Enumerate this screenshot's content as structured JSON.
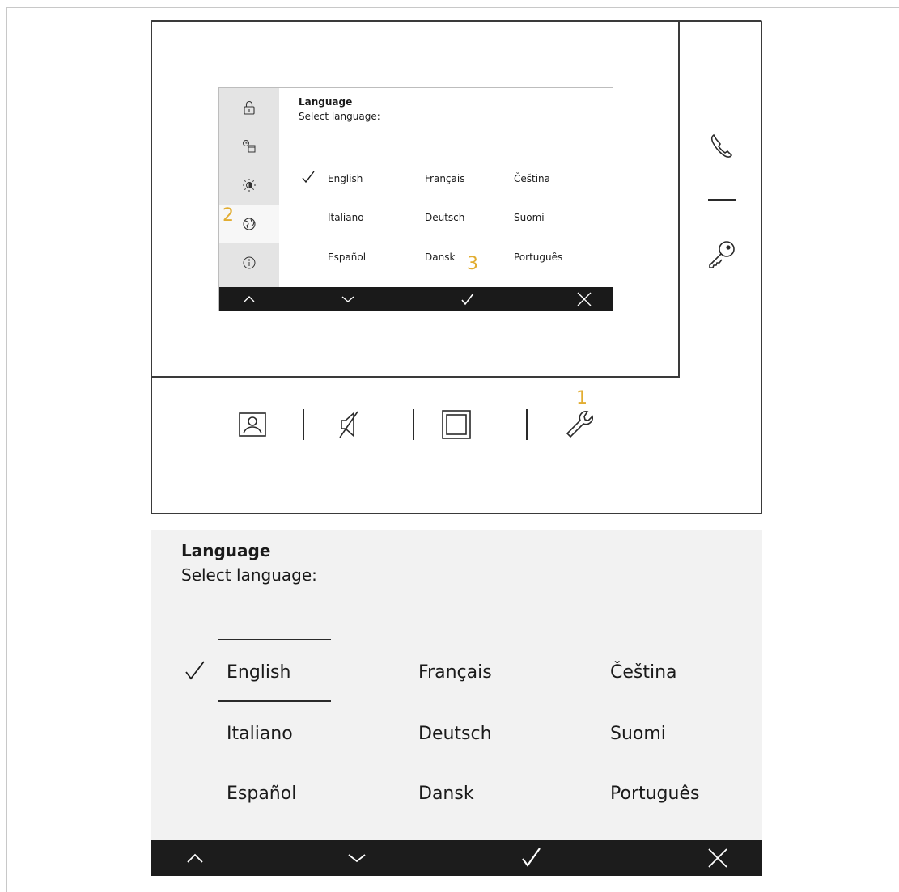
{
  "screen": {
    "title": "Language",
    "subtitle": "Select language:",
    "selected_language": "English",
    "languages": [
      "English",
      "Français",
      "Čeština",
      "Italiano",
      "Deutsch",
      "Suomi",
      "Español",
      "Dansk",
      "Português"
    ],
    "sidebar_icons": [
      "lock-icon",
      "clock-calendar-icon",
      "brightness-icon",
      "language-globe-icon",
      "info-icon"
    ],
    "active_sidebar_item": "language-globe-icon",
    "bottom_bar": [
      "chevron-up-icon",
      "chevron-down-icon",
      "confirm-check-icon",
      "close-icon"
    ]
  },
  "device": {
    "side_buttons": [
      "phone-icon",
      "key-icon"
    ],
    "bottom_buttons": [
      "contact-icon",
      "mute-icon",
      "screen-icon",
      "settings-wrench-icon"
    ]
  },
  "steps": {
    "s1": "1",
    "s2": "2",
    "s3": "3"
  },
  "panel": {
    "title": "Language",
    "subtitle": "Select language:",
    "languages": [
      "English",
      "Français",
      "Čeština",
      "Italiano",
      "Deutsch",
      "Suomi",
      "Español",
      "Dansk",
      "Português"
    ]
  },
  "colors": {
    "step_accent": "#e2ad31",
    "bar": "#1a1a1a",
    "sidebar": "#e4e4e4",
    "panel_bg": "#f2f2f2"
  }
}
